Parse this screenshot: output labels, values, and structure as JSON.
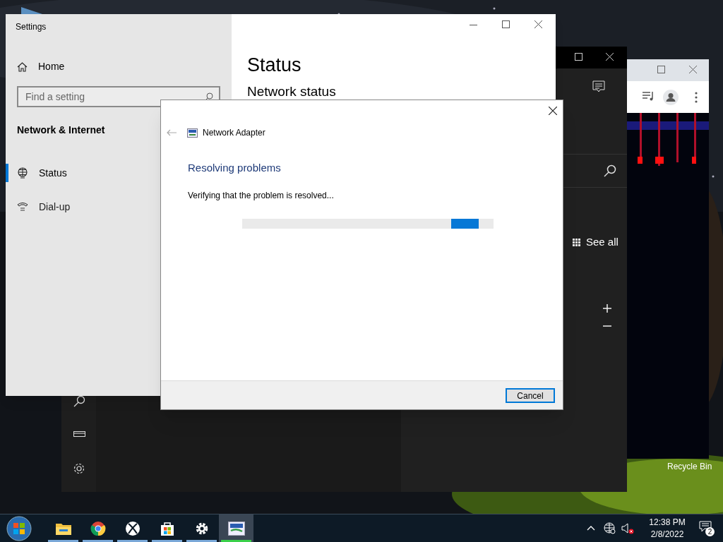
{
  "desktop": {
    "recycle_bin_label": "Recycle Bin"
  },
  "maps_window": {
    "see_all": "See all"
  },
  "settings_window": {
    "title": "Settings",
    "home": "Home",
    "search": {
      "placeholder": "Find a setting"
    },
    "section": "Network & Internet",
    "nav_items": [
      {
        "label": "Status",
        "kind": "globe",
        "selected": true
      },
      {
        "label": "Dial-up",
        "kind": "phone",
        "selected": false
      }
    ],
    "page_title": "Status",
    "page_subtitle": "Network status"
  },
  "dialog": {
    "app_name": "Network Adapter",
    "heading": "Resolving problems",
    "message": "Verifying that the problem is resolved...",
    "progress": {
      "level": 0.94
    },
    "buttons": [
      "Cancel"
    ]
  },
  "taskbar": {
    "apps": [
      {
        "kind": "explorer",
        "selected": false
      },
      {
        "kind": "chrome",
        "selected": false
      },
      {
        "kind": "xbox",
        "selected": false
      },
      {
        "kind": "store",
        "selected": false
      },
      {
        "kind": "settings",
        "selected": false
      },
      {
        "kind": "troubleshooter",
        "selected": true
      }
    ],
    "time": "12:38 PM",
    "date": "2/8/2022",
    "notification_count": "2"
  }
}
